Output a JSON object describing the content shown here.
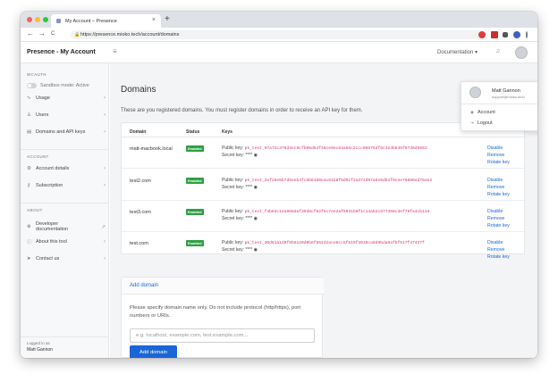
{
  "browser": {
    "tab_title": "My Account – Presence",
    "tab_close": "×",
    "new_tab": "+",
    "url": "https://presence.mioko.tech/account/domains",
    "back": "←",
    "forward": "→",
    "reload": "C"
  },
  "header": {
    "brand": "Presence - My Account",
    "documentation_label": "Documentation ▾"
  },
  "sidebar": {
    "sections": {
      "wcauth": "WCAUTH",
      "account": "ACCOUNT",
      "about": "ABOUT"
    },
    "sandbox_label": "Sandbox mode: Active",
    "items": [
      {
        "label": "Usage",
        "icon": "activity-icon",
        "glyph": "∿",
        "chev": "›"
      },
      {
        "label": "Users",
        "icon": "users-icon",
        "glyph": "♙",
        "chev": "›"
      },
      {
        "label": "Domains and API keys",
        "icon": "domains-icon",
        "glyph": "▤",
        "chev": "›"
      },
      {
        "label": "Account details",
        "icon": "account-icon",
        "glyph": "⚙",
        "chev": "›"
      },
      {
        "label": "Subscription",
        "icon": "key-icon",
        "glyph": "⚷",
        "chev": "›"
      },
      {
        "label": "Developer documentation",
        "icon": "book-icon",
        "glyph": "⊕",
        "chev": "↗"
      },
      {
        "label": "About this tool",
        "icon": "info-icon",
        "glyph": "ⓘ",
        "chev": "›"
      },
      {
        "label": "Contact us",
        "icon": "send-icon",
        "glyph": "➤",
        "chev": "›"
      }
    ],
    "logged_in_label": "Logged in as",
    "logged_in_user": "Matt Gannon"
  },
  "main": {
    "title": "Domains",
    "intro": "These are you registered domains. You must register domains in order to receive an API key for them.",
    "table": {
      "headers": [
        "Domain",
        "Status",
        "Keys"
      ],
      "rows": [
        {
          "domain": "matt-macbook.local",
          "status": "Enabled",
          "public_label": "Public key:",
          "public_key": "pk_test_07a72c378d4ec9cfb06d54f48ce6ec63a55c2ccc066763f6c324b645f07d6d5653",
          "secret_label": "Secret key: ****",
          "actions": [
            "Disable",
            "Remove",
            "Rotate key"
          ]
        },
        {
          "domain": "test2.com",
          "status": "Enabled",
          "public_label": "Public key:",
          "public_key": "pk_test_2ef29e5b7d5eeb4fc5b61b0e3c61b8f6d91f2ad72d97a5e5db1f9cee76886ed75ee2",
          "secret_label": "Secret key: ****",
          "actions": [
            "Disable",
            "Remove",
            "Rotate key"
          ]
        },
        {
          "domain": "test3.com",
          "status": "Enabled",
          "public_label": "Public key:",
          "public_key": "pk_test_f4b83c1ea966daf39d8cf62f5c7ee2af6931b8f1c14ab2c677356c3ef79fa4cb115",
          "secret_label": "Secret key: ****",
          "actions": [
            "Disable",
            "Remove",
            "Rotate key"
          ]
        },
        {
          "domain": "test.com",
          "status": "Enabled",
          "public_label": "Public key:",
          "public_key": "pk_test_30d51a1d9f6b5120d0b6f65242ace6cc5f516f3935ca0d9bda0afbf517f47437f",
          "secret_label": "Secret key: ****",
          "actions": [
            "Disable",
            "Remove",
            "Rotate key"
          ]
        }
      ]
    }
  },
  "add_domain": {
    "heading": "Add domain",
    "help": "Please specify domain name only. Do not include protocol (http/https), port numbers or URIs.",
    "placeholder": "e.g. localhost, example.com, test.example.com...",
    "button": "Add domain"
  },
  "user_menu": {
    "name": "Matt Gannon",
    "email": "support@mioko.tech",
    "items": [
      {
        "label": "Account",
        "icon": "user-icon",
        "glyph": "◉"
      },
      {
        "label": "Logout",
        "icon": "logout-icon",
        "glyph": "⇥"
      }
    ]
  },
  "colors": {
    "accent": "#1a66d6",
    "enabled_badge": "#2e9e44",
    "key_text": "#d6336c"
  }
}
